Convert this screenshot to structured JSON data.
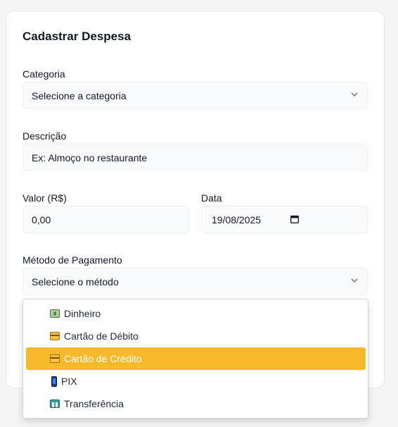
{
  "form": {
    "title": "Cadastrar Despesa",
    "category_label": "Categoria",
    "category_value": "Selecione a categoria",
    "description_label": "Descrição",
    "description_placeholder": "Ex: Almoço no restaurante",
    "value_label": "Valor (R$)",
    "value_placeholder": "0,00",
    "date_label": "Data",
    "date_value": "19/08/2025",
    "payment_label": "Método de Pagamento",
    "payment_value": "Selecione o método"
  },
  "payment_options": [
    {
      "label": "Dinheiro",
      "icon": "cash-icon"
    },
    {
      "label": "Cartão de Débito",
      "icon": "credit-card-icon"
    },
    {
      "label": "Cartão de Crédito",
      "icon": "credit-card-icon",
      "selected": true
    },
    {
      "label": "PIX",
      "icon": "mobile-phone-icon"
    },
    {
      "label": "Transferência",
      "icon": "bank-icon"
    }
  ],
  "colors": {
    "highlight": "#f6b929",
    "card_bg": "#ffffff",
    "field_bg": "#f9fafb"
  }
}
